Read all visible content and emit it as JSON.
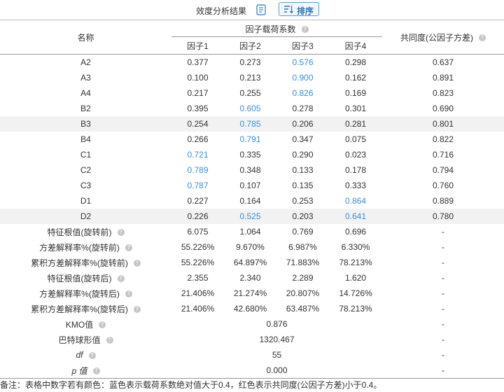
{
  "header": {
    "title": "效度分析结果",
    "sort_label": "排序"
  },
  "table": {
    "col_name": "名称",
    "col_group": "因子载荷系数",
    "col_comm": "共同度(公因子方差)",
    "factors": [
      "因子1",
      "因子2",
      "因子3",
      "因子4"
    ],
    "rows": [
      {
        "name": "A2",
        "v": [
          "0.377",
          "0.273",
          "0.576",
          "0.298"
        ],
        "comm": "0.637",
        "blue": [
          false,
          false,
          true,
          false
        ],
        "shade": false
      },
      {
        "name": "A3",
        "v": [
          "0.100",
          "0.213",
          "0.900",
          "0.162"
        ],
        "comm": "0.891",
        "blue": [
          false,
          false,
          true,
          false
        ],
        "shade": false
      },
      {
        "name": "A4",
        "v": [
          "0.217",
          "0.255",
          "0.826",
          "0.169"
        ],
        "comm": "0.823",
        "blue": [
          false,
          false,
          true,
          false
        ],
        "shade": false
      },
      {
        "name": "B2",
        "v": [
          "0.395",
          "0.605",
          "0.278",
          "0.301"
        ],
        "comm": "0.690",
        "blue": [
          false,
          true,
          false,
          false
        ],
        "shade": false
      },
      {
        "name": "B3",
        "v": [
          "0.254",
          "0.785",
          "0.206",
          "0.281"
        ],
        "comm": "0.801",
        "blue": [
          false,
          true,
          false,
          false
        ],
        "shade": true
      },
      {
        "name": "B4",
        "v": [
          "0.266",
          "0.791",
          "0.347",
          "0.075"
        ],
        "comm": "0.822",
        "blue": [
          false,
          true,
          false,
          false
        ],
        "shade": false
      },
      {
        "name": "C1",
        "v": [
          "0.721",
          "0.335",
          "0.290",
          "0.023"
        ],
        "comm": "0.716",
        "blue": [
          true,
          false,
          false,
          false
        ],
        "shade": false
      },
      {
        "name": "C2",
        "v": [
          "0.789",
          "0.348",
          "0.133",
          "0.178"
        ],
        "comm": "0.794",
        "blue": [
          true,
          false,
          false,
          false
        ],
        "shade": false
      },
      {
        "name": "C3",
        "v": [
          "0.787",
          "0.107",
          "0.135",
          "0.333"
        ],
        "comm": "0.760",
        "blue": [
          true,
          false,
          false,
          false
        ],
        "shade": false
      },
      {
        "name": "D1",
        "v": [
          "0.227",
          "0.164",
          "0.253",
          "0.864"
        ],
        "comm": "0.889",
        "blue": [
          false,
          false,
          false,
          true
        ],
        "shade": false
      },
      {
        "name": "D2",
        "v": [
          "0.226",
          "0.525",
          "0.203",
          "0.641"
        ],
        "comm": "0.780",
        "blue": [
          false,
          true,
          false,
          true
        ],
        "shade": true
      }
    ],
    "stats": [
      {
        "name": "特征根值(旋转前)",
        "v": [
          "6.075",
          "1.064",
          "0.769",
          "0.696"
        ],
        "comm": "-"
      },
      {
        "name": "方差解释率%(旋转前)",
        "v": [
          "55.226%",
          "9.670%",
          "6.987%",
          "6.330%"
        ],
        "comm": "-"
      },
      {
        "name": "累积方差解释率%(旋转前)",
        "v": [
          "55.226%",
          "64.897%",
          "71.883%",
          "78.213%"
        ],
        "comm": "-"
      },
      {
        "name": "特征根值(旋转后)",
        "v": [
          "2.355",
          "2.340",
          "2.289",
          "1.620"
        ],
        "comm": "-"
      },
      {
        "name": "方差解释率%(旋转后)",
        "v": [
          "21.406%",
          "21.274%",
          "20.807%",
          "14.726%"
        ],
        "comm": "-"
      },
      {
        "name": "累积方差解释率%(旋转后)",
        "v": [
          "21.406%",
          "42.680%",
          "63.487%",
          "78.213%"
        ],
        "comm": "-"
      }
    ],
    "tests": [
      {
        "name": "KMO值",
        "value": "0.876",
        "comm": "-",
        "italic": false
      },
      {
        "name": "巴特球形值",
        "value": "1320.467",
        "comm": "-",
        "italic": false
      },
      {
        "name": "df",
        "value": "55",
        "comm": "-",
        "italic": true
      },
      {
        "name": "p 值",
        "value": "0.000",
        "comm": "-",
        "italic": true
      }
    ],
    "help_glyph": "?"
  },
  "note": "备注：表格中数字若有颜色：蓝色表示载荷系数绝对值大于0.4，红色表示共同度(公因子方差)小于0.4。",
  "colors": {
    "highlight_blue": "#3a8fd9",
    "shade": "#f2f2f2",
    "accent": "#2e75b6"
  }
}
